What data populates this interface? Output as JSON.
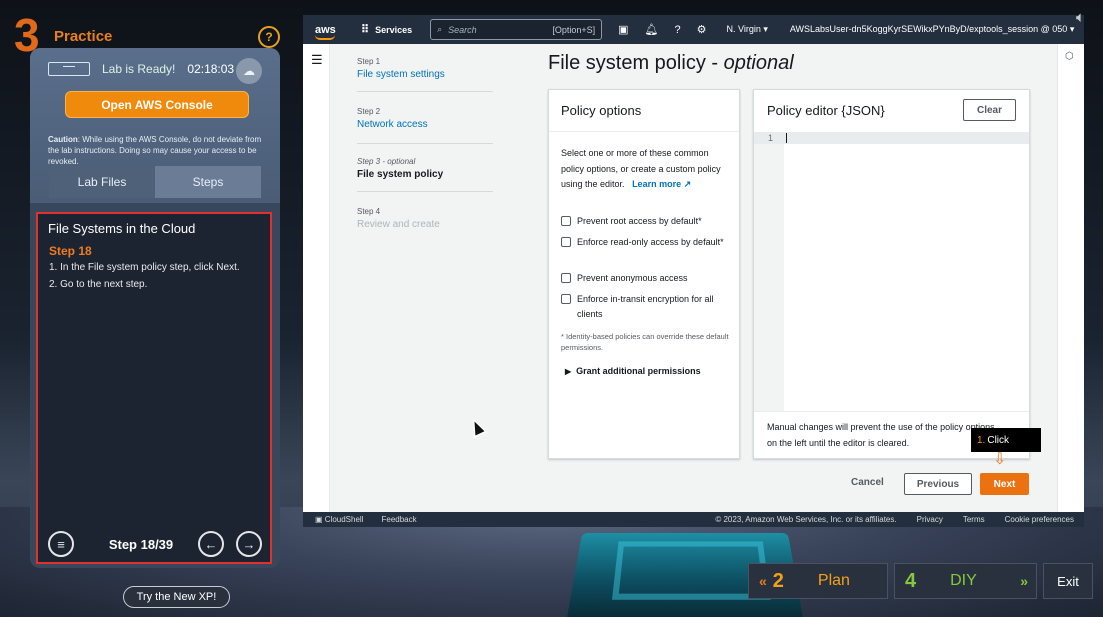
{
  "practice": {
    "number": "3",
    "label": "Practice",
    "help": "?"
  },
  "lab": {
    "status": "Lab is Ready!",
    "timer": "02:18:03",
    "open_console": "Open AWS Console",
    "caution_bold": "Caution",
    "caution_text": ": While using the AWS Console, do not deviate from the lab instructions. Doing so may cause your access to be revoked.",
    "tabs": [
      "Lab Files",
      "Steps"
    ],
    "active_tab": "Steps"
  },
  "steps_panel": {
    "title": "File Systems in the Cloud",
    "step_label": "Step 18",
    "lines": [
      "1. In the File system policy step, click Next.",
      "2. Go to the next step."
    ],
    "counter": "Step 18/39"
  },
  "try_xp": "Try the New XP!",
  "console": {
    "logo": "aws",
    "services": "Services",
    "search_placeholder": "Search",
    "search_shortcut": "[Option+S]",
    "region": "N. Virgin",
    "account": "AWSLabsUser-dn5KoggKyrSEWikxPYnByD/exptools_session @ 050",
    "wizard": [
      {
        "step": "Step 1",
        "name": "File system settings"
      },
      {
        "step": "Step 2",
        "name": "Network access"
      },
      {
        "step": "Step 3 - optional",
        "name": "File system policy"
      },
      {
        "step": "Step 4",
        "name": "Review and create"
      }
    ],
    "page_title": "File system policy",
    "page_title_suffix": "optional",
    "policy_options": {
      "heading": "Policy options",
      "description": "Select one or more of these common policy options, or create a custom policy using the editor.",
      "learn_more": "Learn more",
      "checkboxes": [
        "Prevent root access by default*",
        "Enforce read-only access by default*",
        "Prevent anonymous access",
        "Enforce in-transit encryption for all clients"
      ],
      "note": "* Identity-based policies can override these default permissions.",
      "grant": "Grant additional permissions"
    },
    "editor": {
      "heading": "Policy editor {JSON}",
      "clear": "Clear",
      "line_number": "1",
      "note": "Manual changes will prevent the use of the policy options on the left until the editor is cleared."
    },
    "actions": {
      "cancel": "Cancel",
      "previous": "Previous",
      "next": "Next"
    },
    "tooltip": {
      "num": "1.",
      "text": "Click"
    },
    "footer": {
      "cloudshell": "CloudShell",
      "feedback": "Feedback",
      "copyright": "© 2023, Amazon Web Services, Inc. or its affiliates.",
      "privacy": "Privacy",
      "terms": "Terms",
      "cookies": "Cookie preferences"
    }
  },
  "bottom_nav": {
    "plan_num": "2",
    "plan": "Plan",
    "diy_num": "4",
    "diy": "DIY",
    "exit": "Exit"
  },
  "colors": {
    "accent_orange": "#ec7211",
    "aws_dark": "#232f3e",
    "link_blue": "#0073bb",
    "highlight_red": "#e03030"
  }
}
